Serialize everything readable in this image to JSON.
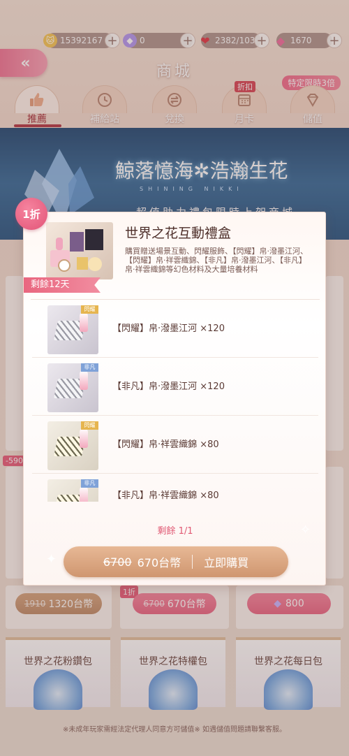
{
  "currencies": {
    "gold": "15392167",
    "diamond": "0",
    "stamina": "2382/103",
    "pink_gem": "1670"
  },
  "header": {
    "back_icon": "«",
    "title": "商城",
    "limit_badge": "特定限時3倍"
  },
  "tabs": [
    {
      "label": "推薦",
      "icon": "thumbs-up",
      "active": true
    },
    {
      "label": "補給站",
      "icon": "clock"
    },
    {
      "label": "兌換",
      "icon": "exchange"
    },
    {
      "label": "月卡",
      "icon": "calendar",
      "tag": "折扣"
    },
    {
      "label": "儲值",
      "icon": "diamond"
    }
  ],
  "banner": {
    "title": "鯨落憶海✲浩瀚生花",
    "subtitle": "SHINING NIKKI",
    "line": "超值助力禮包限時上架商城"
  },
  "popup": {
    "discount": "1折",
    "title": "世界之花互動禮盒",
    "description": "購買贈送場景互動、閃耀服飾、【閃耀】帛·潑墨江河、【閃耀】帛·祥雲織錦、【非凡】帛·潑墨江河、【非凡】帛·祥雲織錦等幻色材料及大量培養材料",
    "remaining_time": "剩餘12天",
    "items": [
      {
        "name": "【閃耀】帛·潑墨江河 ×120",
        "rarity": "閃耀",
        "color": "gold"
      },
      {
        "name": "【非凡】帛·潑墨江河 ×120",
        "rarity": "非凡",
        "color": "blue"
      },
      {
        "name": "【閃耀】帛·祥雲織錦 ×80",
        "rarity": "閃耀",
        "color": "gold"
      },
      {
        "name": "【非凡】帛·祥雲織錦 ×80",
        "rarity": "非凡",
        "color": "blue"
      }
    ],
    "remaining_count": "剩餘 1/1",
    "old_price": "6700",
    "price": "670台幣",
    "buy_label": "立即購買"
  },
  "background": {
    "card_a_old": "1910",
    "card_a_price": "1320台幣",
    "card_b_badge": "1折",
    "card_b_old": "6700",
    "card_b_price": "670台幣",
    "card_c_price": "800",
    "side_discount": "-590",
    "bundles": [
      "世界之花粉鑽包",
      "世界之花特權包",
      "世界之花每日包"
    ]
  },
  "footer": "※未成年玩家需經法定代理人同意方可儲值※ 如遇儲值問題請聯繫客服。",
  "colors": {
    "accent_pink": "#ea6a87",
    "gold_button": "#cf9670",
    "active_tab": "#a8323e"
  }
}
